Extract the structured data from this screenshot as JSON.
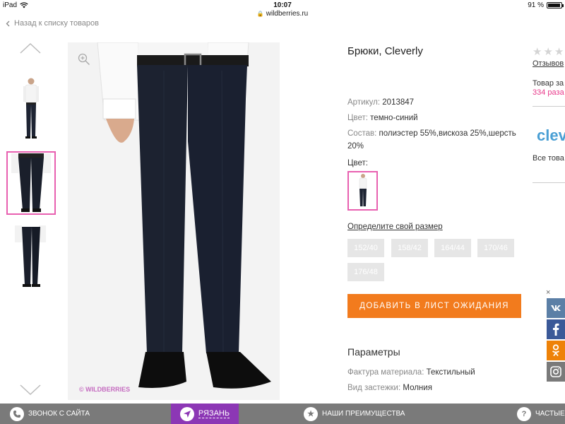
{
  "status_bar": {
    "device": "iPad",
    "time": "10:07",
    "battery": "91 %"
  },
  "browser": {
    "url": "wildberries.ru"
  },
  "nav": {
    "back_label": "Назад к списку товаров"
  },
  "gallery": {
    "watermark": "© WILDBERRIES",
    "thumbnail_count": 3,
    "active_index": 1
  },
  "product": {
    "title": "Брюки, Cleverly",
    "article_label": "Артикул:",
    "article_value": "2013847",
    "color_label": "Цвет:",
    "color_value": "темно-синий",
    "composition_label": "Состав:",
    "composition_value": "полиэстер 55%,вискоза 25%,шерсть",
    "composition_value_2": "20%",
    "color_picker_label": "Цвет:",
    "size_link": "Определите свой размер",
    "sizes": [
      "152/40",
      "158/42",
      "164/44",
      "170/46",
      "176/48"
    ],
    "cta_label": "ДОБАВИТЬ В ЛИСТ ОЖИДАНИЯ",
    "params_title": "Параметры",
    "params": [
      {
        "label": "Фактура материала:",
        "value": "Текстильный"
      },
      {
        "label": "Вид застежки:",
        "value": "Молния"
      }
    ]
  },
  "side": {
    "reviews": "Отзывов",
    "sold_line1": "Товар за",
    "sold_line2": "334 раза",
    "brand_logo_text": "clev",
    "all_goods": "Все това"
  },
  "social": {
    "close": "×",
    "items": [
      {
        "name": "vk",
        "glyph": "vk",
        "color": "#5b7fa6"
      },
      {
        "name": "facebook",
        "glyph": "f",
        "color": "#3b5998"
      },
      {
        "name": "odnoklassniki",
        "glyph": "ok",
        "color": "#ee8208"
      },
      {
        "name": "instagram",
        "glyph": "ig",
        "color": "#7a7a7a"
      }
    ]
  },
  "bottom_bar": {
    "call": "ЗВОНОК С САЙТА",
    "city": "РЯЗАНЬ",
    "advantages": "НАШИ ПРЕИМУЩЕСТВА",
    "faq": "ЧАСТЫЕ"
  },
  "colors": {
    "accent_pink": "#e860b0",
    "cta_orange": "#f27b1d",
    "city_purple": "#8c37b5",
    "bottom_bar_gray": "#7a7a7a"
  }
}
